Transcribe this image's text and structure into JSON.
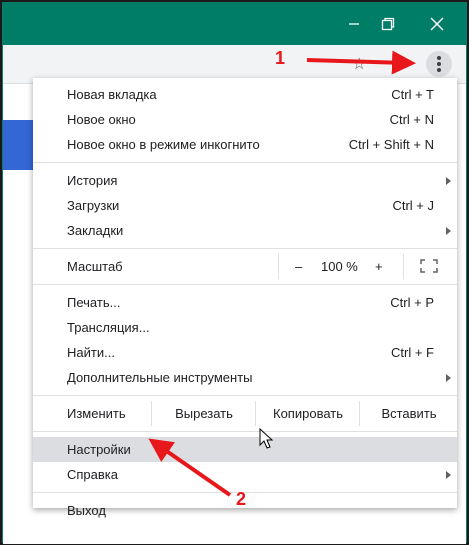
{
  "window": {
    "minimize_label": "—",
    "restore_label": "❐",
    "close_label": "✕"
  },
  "toolbar": {
    "star_icon": "star-icon",
    "menu_icon": "kebab-menu-icon"
  },
  "menu": {
    "group1": [
      {
        "label": "Новая вкладка",
        "shortcut": "Ctrl + T"
      },
      {
        "label": "Новое окно",
        "shortcut": "Ctrl + N"
      },
      {
        "label": "Новое окно в режиме инкогнито",
        "shortcut": "Ctrl + Shift + N"
      }
    ],
    "group2": [
      {
        "label": "История",
        "shortcut": ""
      },
      {
        "label": "Загрузки",
        "shortcut": "Ctrl + J"
      },
      {
        "label": "Закладки",
        "shortcut": ""
      }
    ],
    "zoom": {
      "label": "Масштаб",
      "minus": "–",
      "value": "100 %",
      "plus": "+"
    },
    "group3": [
      {
        "label": "Печать...",
        "shortcut": "Ctrl + P"
      },
      {
        "label": "Трансляция...",
        "shortcut": ""
      },
      {
        "label": "Найти...",
        "shortcut": "Ctrl + F"
      },
      {
        "label": "Дополнительные инструменты",
        "shortcut": ""
      }
    ],
    "edit": {
      "label": "Изменить",
      "cut": "Вырезать",
      "copy": "Копировать",
      "paste": "Вставить"
    },
    "group4": [
      {
        "label": "Настройки",
        "shortcut": ""
      },
      {
        "label": "Справка",
        "shortcut": ""
      }
    ],
    "exit": {
      "label": "Выход"
    }
  },
  "annotations": {
    "marker1": "1",
    "marker2": "2",
    "arrow_color": "#e8171b"
  },
  "colors": {
    "titlebar": "#007d67",
    "highlight": "#dcdde0",
    "accent_blue": "#3367d6"
  }
}
